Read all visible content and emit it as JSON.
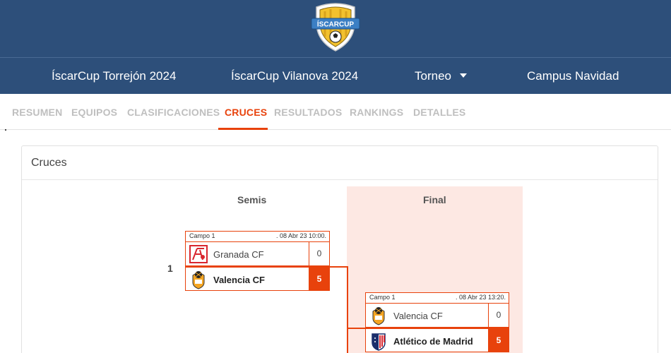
{
  "header": {
    "logo_text": "ÍSCARCUP",
    "nav": [
      {
        "label": "ÍscarCup Torrejón 2024"
      },
      {
        "label": "ÍscarCup Vilanova 2024"
      },
      {
        "label": "Torneo"
      },
      {
        "label": "Campus Navidad"
      }
    ]
  },
  "tabs": [
    {
      "label": "RESUMEN"
    },
    {
      "label": "EQUIPOS"
    },
    {
      "label": "CLASIFICACIONES"
    },
    {
      "label": "CRUCES"
    },
    {
      "label": "RESULTADOS"
    },
    {
      "label": "RANKINGS"
    },
    {
      "label": "DETALLES"
    }
  ],
  "active_tab": "CRUCES",
  "panel": {
    "title": "Cruces",
    "rounds": [
      {
        "label": "Semis"
      },
      {
        "label": "Final"
      }
    ]
  },
  "matches": [
    {
      "number": "1",
      "field": "Campo 1",
      "date": ". 08 Abr 23 10:00.",
      "teams": [
        {
          "name": "Granada CF",
          "score": "0",
          "crest": "granada-crest-icon"
        },
        {
          "name": "Valencia CF",
          "score": "5",
          "crest": "valencia-crest-icon",
          "winner": true
        }
      ]
    },
    {
      "field": "Campo 1",
      "date": ". 08 Abr 23 13:20.",
      "teams": [
        {
          "name": "Valencia CF",
          "score": "0",
          "crest": "valencia-crest-icon"
        },
        {
          "name": "Atlético de Madrid",
          "score": "5",
          "crest": "atletico-crest-icon",
          "winner": true
        }
      ]
    }
  ],
  "colors": {
    "header_bg": "#2d4f7a",
    "accent": "#e8420c",
    "final_bg": "#fde8e3"
  }
}
